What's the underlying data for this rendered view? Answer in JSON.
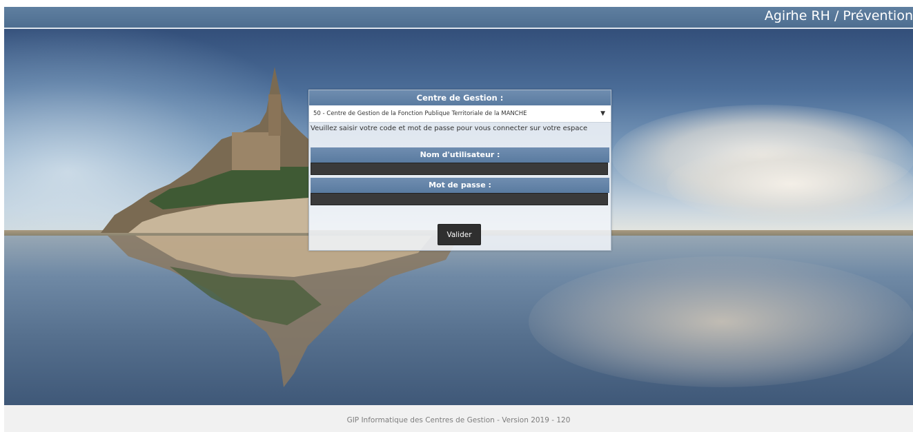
{
  "header": {
    "app_title": "Agirhe RH / Prévention"
  },
  "login": {
    "centre_label": "Centre de Gestion :",
    "centre_selected": "50 - Centre de Gestion de la Fonction Publique Territoriale de la MANCHE",
    "instructions": "Veuillez saisir votre code et mot de passe pour vous connecter sur votre espace",
    "username_label": "Nom d'utilisateur :",
    "username_value": "",
    "password_label": "Mot de passe :",
    "password_value": "",
    "submit_label": "Valider"
  },
  "footer": {
    "text": "GIP Informatique des Centres de Gestion - Version 2019 - 120"
  },
  "icons": {
    "select_arrow": "dropdown-arrow-icon"
  },
  "colors": {
    "header_bar": "#5a7ba0",
    "panel_header": "#6386ab",
    "input_bg": "#3a3a3a",
    "button_bg": "#2f2f2f",
    "footer_bg": "#f1f1f1"
  }
}
